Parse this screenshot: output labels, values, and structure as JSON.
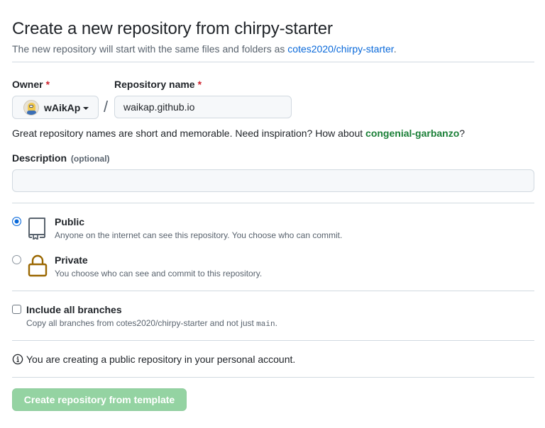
{
  "page": {
    "title": "Create a new repository from chirpy-starter",
    "subtitle_prefix": "The new repository will start with the same files and folders as ",
    "template_link": "cotes2020/chirpy-starter",
    "subtitle_suffix": "."
  },
  "owner": {
    "label": "Owner",
    "required_mark": "*",
    "value": "wAikAp"
  },
  "separator": "/",
  "repo_name": {
    "label": "Repository name",
    "required_mark": "*",
    "value": "waikap.github.io"
  },
  "name_hint": {
    "text": "Great repository names are short and memorable. Need inspiration? How about ",
    "suggestion": "congenial-garbanzo",
    "suffix": "?"
  },
  "description": {
    "label": "Description",
    "optional": "(optional)",
    "value": ""
  },
  "visibility": {
    "selected": "public",
    "public": {
      "title": "Public",
      "desc": "Anyone on the internet can see this repository. You choose who can commit."
    },
    "private": {
      "title": "Private",
      "desc": "You choose who can see and commit to this repository."
    }
  },
  "branches": {
    "title": "Include all branches",
    "desc_prefix": "Copy all branches from cotes2020/chirpy-starter and not just ",
    "desc_code": "main",
    "desc_suffix": "."
  },
  "info_text": "You are creating a public repository in your personal account.",
  "submit_label": "Create repository from template",
  "colors": {
    "link": "#0969da",
    "suggestion": "#1a7f37",
    "required": "#cf222e",
    "submit_disabled": "#94d3a2",
    "lock_icon": "#9a6700"
  },
  "icons": {
    "public": "repo-icon",
    "private": "lock-icon",
    "info": "info-icon",
    "owner_menu": "caret-down-icon"
  }
}
